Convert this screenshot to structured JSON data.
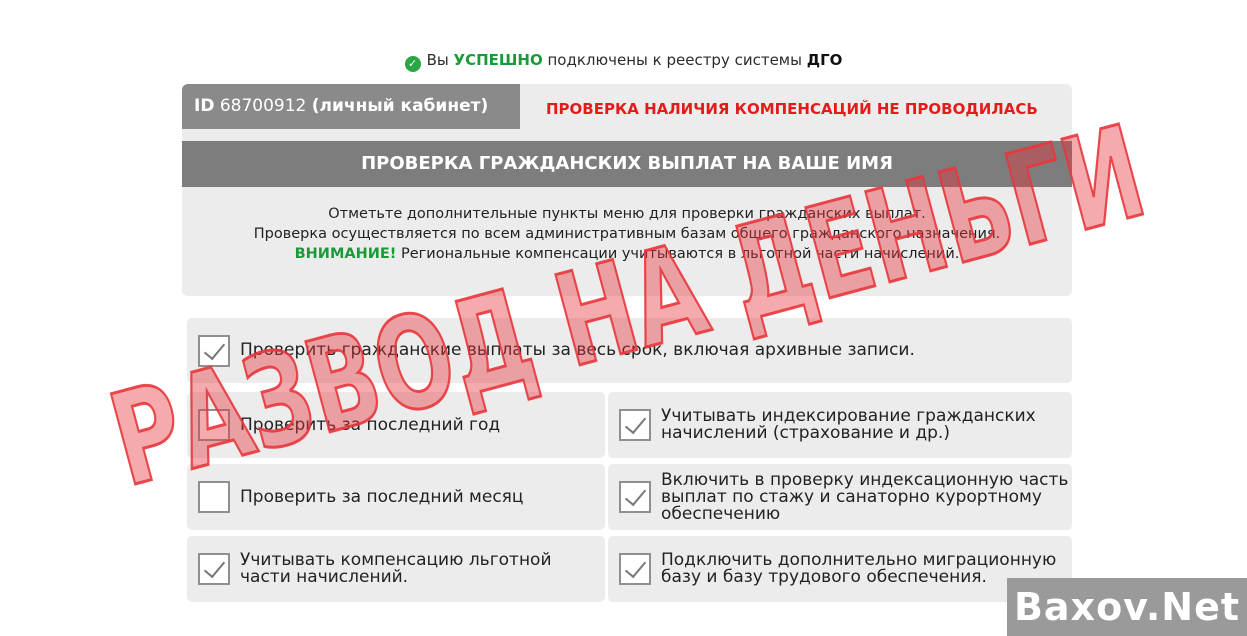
{
  "status": {
    "prefix": "Вы",
    "success": "УСПЕШНО",
    "middle": "подключены к реестру системы",
    "system": "ДГО"
  },
  "account": {
    "id_label": "ID",
    "id_number": "68700912",
    "cabinet": "(личный кабинет)",
    "warning": "ПРОВЕРКА НАЛИЧИЯ КОМПЕНСАЦИЙ НЕ ПРОВОДИЛАСЬ"
  },
  "header": {
    "title": "ПРОВЕРКА ГРАЖДАНСКИХ ВЫПЛАТ НА ВАШЕ ИМЯ"
  },
  "info": {
    "line1": "Отметьте дополнительные пункты меню для проверки гражданских выплат.",
    "line2": "Проверка осуществляется по всем административным базам общего гражданского назначения.",
    "attention": "ВНИМАНИЕ!",
    "line3": "Региональные компенсации учитываются в льготной части начислений."
  },
  "options": [
    {
      "label": "Проверить гражданские выплаты за весь срок, включая архивные записи.",
      "checked": true
    },
    {
      "label": "Проверить за последний год",
      "checked": false
    },
    {
      "label": "Учитывать индексирование гражданских начислений (страхование и др.)",
      "checked": true
    },
    {
      "label": "Проверить за последний месяц",
      "checked": false
    },
    {
      "label": "Включить в проверку индексационную часть выплат по стажу и санаторно курортному обеспечению",
      "checked": true
    },
    {
      "label": "Учитывать компенсацию льготной части начислений.",
      "checked": true
    },
    {
      "label": "Подключить дополнительно миграционную базу и базу трудового обеспечения.",
      "checked": true
    }
  ],
  "stamp": {
    "text": "РАЗВОД НА ДЕНЬГИ",
    "color": "#e8363c"
  },
  "watermark": {
    "text": "Baxov.Net"
  },
  "colors": {
    "success_green": "#1c9a3a",
    "warning_red": "#e41b1b",
    "panel_grey": "#ececec",
    "bar_grey": "#7d7d7d"
  }
}
